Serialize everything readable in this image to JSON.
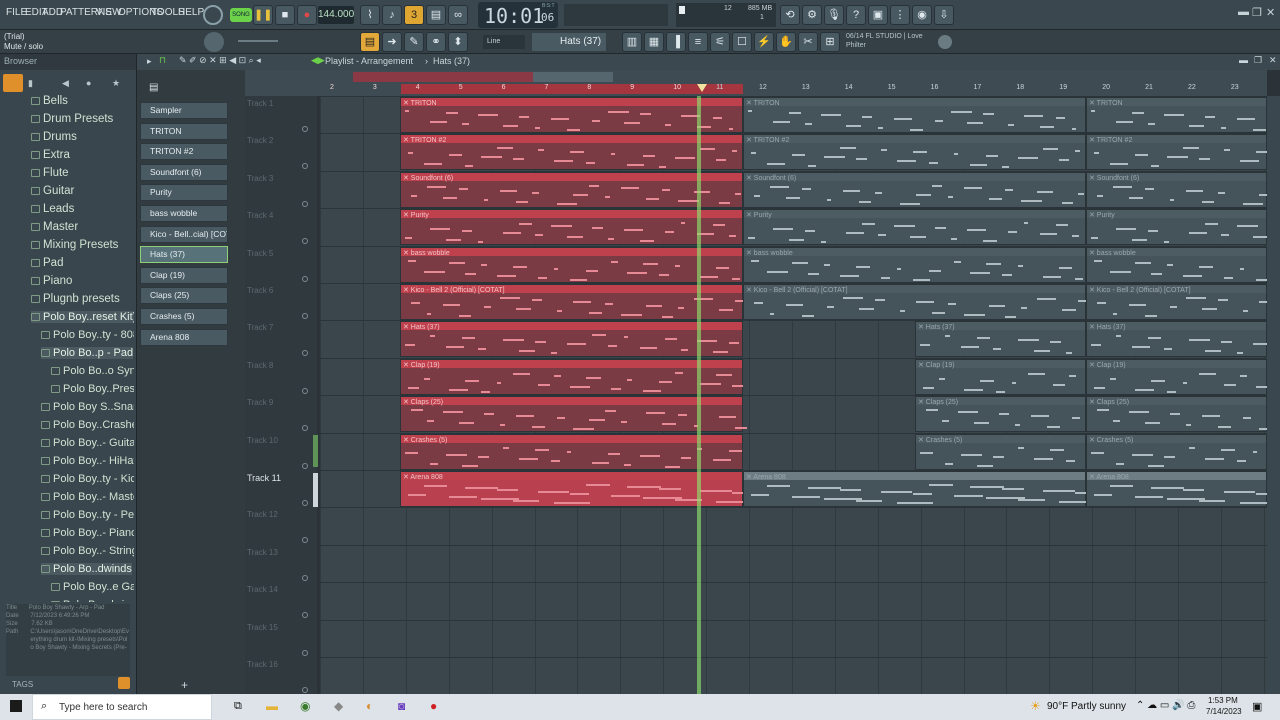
{
  "menu": [
    "FILE",
    "EDIT",
    "ADD",
    "PATTERNS",
    "VIEW",
    "OPTIONS",
    "TOOLS",
    "HELP"
  ],
  "toolbar": {
    "song_label": "SONG",
    "tempo": "144.000",
    "time_main": "10:01",
    "time_sub": "06",
    "time_unit": "B:S:T",
    "cpu_value": "12",
    "mem_value": "885 MB",
    "mem_sub": "1",
    "pattern_name": "Hats (37)",
    "snap_label": "Line",
    "news_text": "06/14  FL STUDIO | Love Philter"
  },
  "hint": {
    "line1": "(Trial)",
    "line2": "Mute / solo"
  },
  "browser": {
    "title": "Browser",
    "items": [
      {
        "label": "Bells"
      },
      {
        "label": "Drum Presets"
      },
      {
        "label": "Drums"
      },
      {
        "label": "Extra"
      },
      {
        "label": "Flute"
      },
      {
        "label": "Guitar"
      },
      {
        "label": "Leads"
      },
      {
        "label": "Master"
      },
      {
        "label": "Mixing Presets"
      },
      {
        "label": "Pad"
      },
      {
        "label": "Piano"
      },
      {
        "label": "Plugnb presets"
      },
      {
        "label": "Polo Boy..reset Kit)"
      },
      {
        "label": "Polo Boy..ty - 808s"
      },
      {
        "label": "Polo Bo..p - Pad"
      },
      {
        "label": "Polo Bo..o Synth"
      },
      {
        "label": "Polo Boy..Preset"
      },
      {
        "label": "Polo Boy S..Snares"
      },
      {
        "label": "Polo Boy..Crashes"
      },
      {
        "label": "Polo Boy..- Guitar"
      },
      {
        "label": "Polo Boy..- HiHats"
      },
      {
        "label": "Polo Boy..ty - Kicks"
      },
      {
        "label": "Polo Boy..- Master"
      },
      {
        "label": "Polo Boy..ty - Perc"
      },
      {
        "label": "Polo Boy..- Pianos"
      },
      {
        "label": "Polo Boy..- Strings"
      },
      {
        "label": "Polo Bo..dwinds"
      },
      {
        "label": "Polo Boy..e Gang"
      },
      {
        "label": "Polo Bo..dwinds"
      }
    ],
    "info": {
      "title_key": "Title",
      "title_val": "Polo Boy Shawty - Arp - Pad",
      "date_key": "Date",
      "date_val": "7/12/2023 6:49:26 PM",
      "size_key": "Size",
      "size_val": "7.62 KB",
      "path_key": "Path",
      "path_val": "C:\\Users\\jason\\OneDrive\\Desktop\\Everything drum kit-\\Mixing presets\\Polo Boy Shawty - Mixing Secrets (Pre-"
    },
    "tags_label": "TAGS"
  },
  "channels": [
    "Sampler",
    "TRITON",
    "TRITON #2",
    "Soundfont (6)",
    "Purity",
    "bass wobble",
    "Kico - Bell..cial) [COTAT]",
    "Hats (37)",
    "Clap (19)",
    "Claps (25)",
    "Crashes (5)",
    "Arena 808"
  ],
  "playlist": {
    "title": "Playlist - Arrangement",
    "pattern": "Hats (37)",
    "bar_numbers": [
      "2",
      "3",
      "4",
      "5",
      "6",
      "7",
      "8",
      "9",
      "10",
      "11",
      "12",
      "13",
      "14",
      "15",
      "16",
      "17",
      "18",
      "19",
      "20",
      "21",
      "22",
      "23"
    ]
  },
  "tracks": [
    "Track 1",
    "Track 2",
    "Track 3",
    "Track 4",
    "Track 5",
    "Track 6",
    "Track 7",
    "Track 8",
    "Track 9",
    "Track 10",
    "Track 11",
    "Track 12",
    "Track 13",
    "Track 14",
    "Track 15",
    "Track 16"
  ],
  "clips": [
    {
      "track": 0,
      "name": "TRITON"
    },
    {
      "track": 1,
      "name": "TRITON #2"
    },
    {
      "track": 2,
      "name": "Soundfont (6)"
    },
    {
      "track": 3,
      "name": "Purity"
    },
    {
      "track": 4,
      "name": "bass wobble"
    },
    {
      "track": 5,
      "name": "Kico - Bell 2 (Official) [COTAT]"
    },
    {
      "track": 6,
      "name": "Hats (37)"
    },
    {
      "track": 7,
      "name": "Clap (19)"
    },
    {
      "track": 8,
      "name": "Claps (25)"
    },
    {
      "track": 9,
      "name": "Crashes (5)"
    },
    {
      "track": 10,
      "name": "Arena 808"
    }
  ],
  "taskbar": {
    "search_placeholder": "Type here to search",
    "weather": "90°F  Partly sunny",
    "time": "1:53 PM",
    "date": "7/14/2023"
  }
}
